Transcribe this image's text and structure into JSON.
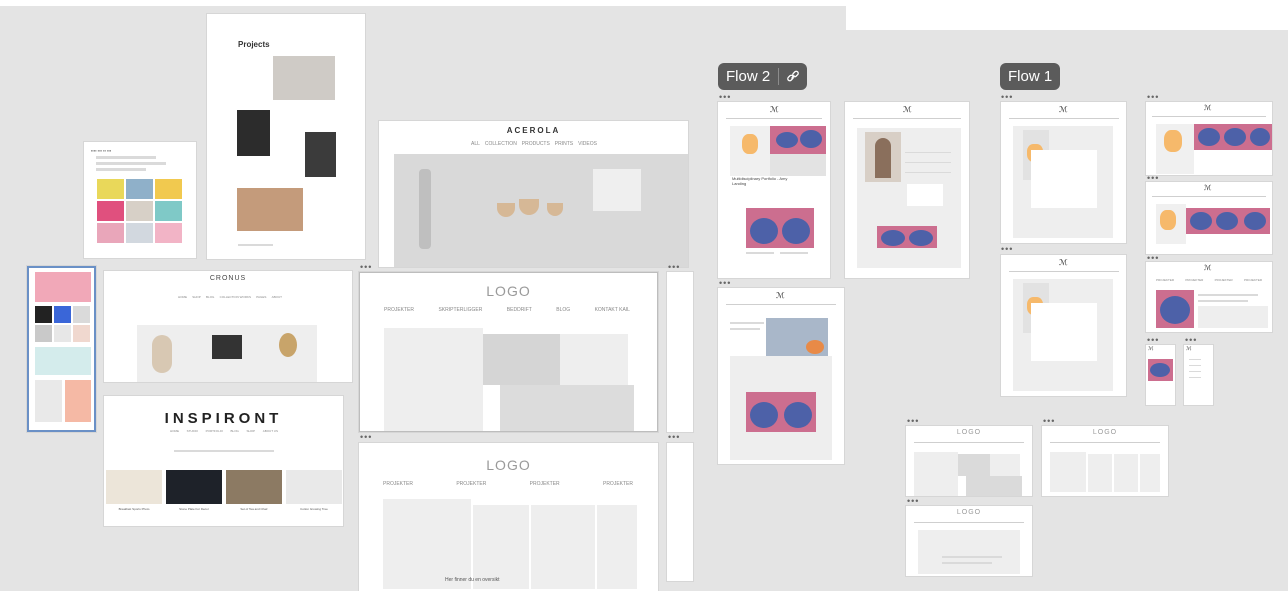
{
  "flows": {
    "flow2": {
      "label": "Flow 2"
    },
    "flow1": {
      "label": "Flow 1"
    }
  },
  "dots": "•••",
  "frames": {
    "projects": {
      "title": "Projects"
    },
    "acerola": {
      "title": "ACEROLA",
      "nav": [
        "ALL",
        "COLLECTION",
        "PRODUCTS",
        "PRINTS",
        "VIDEOS"
      ]
    },
    "cronus": {
      "title": "CRONUS",
      "nav": [
        "HOME",
        "SHOP",
        "BLOG",
        "COLLECTION WORKS",
        "PAGES",
        "ABOUT"
      ]
    },
    "inspiront": {
      "title": "INSPIRONT",
      "nav": [
        "HOME",
        "STUDIO",
        "PORTFOLIO",
        "BLOG",
        "SHOP",
        "ABOUT US"
      ],
      "items": [
        "Breakfast Sports Photo",
        "Stone Plate For Decor",
        "Set of Tea and Chair",
        "Cotton Growing Tree"
      ]
    },
    "logo_a": {
      "logo": "LOGO",
      "nav": [
        "PROJEKTER",
        "SKRIPTERLIGGER",
        "BEDDRIFT",
        "BLOG",
        "KONTAKT KAIL"
      ]
    },
    "logo_b": {
      "logo": "LOGO",
      "nav": [
        "PROJEKTER",
        "PROJEKTER",
        "PROJEKTER",
        "PROJEKTER"
      ],
      "caption": "Her finner du en oversikt"
    },
    "flow2_hero": {
      "heading": "Multidisciplinary Portfolio - Amy Landing"
    },
    "flow1_right": {
      "nav": [
        "PROJEKTER",
        "PROJEKTER",
        "PROJEKTER",
        "PROJEKTER"
      ]
    },
    "wire_small": {
      "logo": "LOGO"
    }
  },
  "colors": {
    "canvas": "#e4e4e4",
    "pill": "#5b5b5b",
    "sushi_bg": "#cc6e8f",
    "plate": "#4d61a8"
  }
}
